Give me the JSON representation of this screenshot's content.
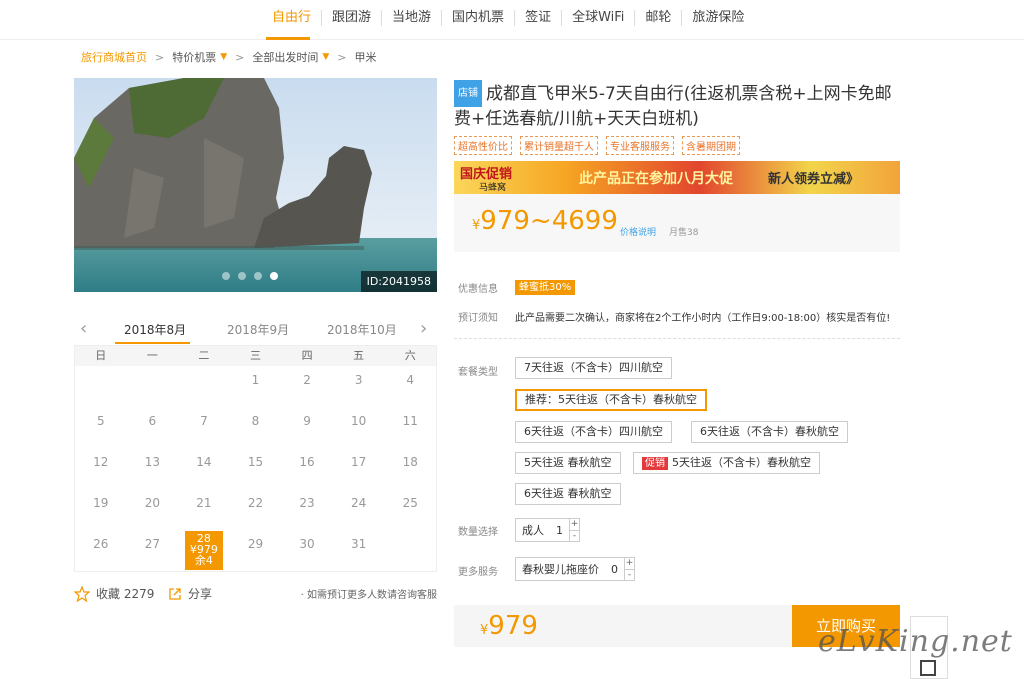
{
  "nav": {
    "items": [
      "自由行",
      "跟团游",
      "当地游",
      "国内机票",
      "签证",
      "全球WiFi",
      "邮轮",
      "旅游保险"
    ],
    "active": "自由行"
  },
  "breadcrumb": {
    "home": "旅行商城首页",
    "b1": "特价机票",
    "b2": "全部出发时间",
    "b3": "甲米"
  },
  "gallery": {
    "image_id": "ID:2041958",
    "slides": 4,
    "active_slide": 4
  },
  "calendar": {
    "months": [
      "2018年8月",
      "2018年9月",
      "2018年10月"
    ],
    "weekdays": [
      "日",
      "一",
      "二",
      "三",
      "四",
      "五",
      "六"
    ],
    "weeks": [
      [
        "",
        "",
        "",
        "1",
        "2",
        "3",
        "4"
      ],
      [
        "5",
        "6",
        "7",
        "8",
        "9",
        "10",
        "11"
      ],
      [
        "12",
        "13",
        "14",
        "15",
        "16",
        "17",
        "18"
      ],
      [
        "19",
        "20",
        "21",
        "22",
        "23",
        "24",
        "25"
      ],
      [
        "26",
        "27",
        "28",
        "29",
        "30",
        "31",
        ""
      ]
    ],
    "selected": {
      "day": "28",
      "price": "¥979",
      "stock": "余4"
    }
  },
  "actions": {
    "fav_label": "收藏 2279",
    "share_label": "分享",
    "note": "· 如需预订更多人数请咨询客服"
  },
  "product": {
    "shop_tag": "店铺",
    "title": "成都直飞甲米5-7天自由行(往返机票含税+上网卡免邮费+任选春航/川航+天天白班机)",
    "tags": [
      "超高性价比",
      "累计销量超千人",
      "专业客服服务",
      "含暑期团期"
    ]
  },
  "banner": {
    "t1": "国庆促销",
    "t2": "马蜂窝",
    "t3": "此产品正在参加八月大促",
    "t4": "新人领券立减》"
  },
  "price": {
    "symbol": "¥",
    "range": "979~4699",
    "explain": "价格说明",
    "sold": "月售38"
  },
  "info": {
    "discount_label": "优惠信息",
    "discount_value": "蜂蜜抵30%",
    "booking_label": "预订须知",
    "booking_value": "此产品需要二次确认，商家将在2个工作小时内（工作日9:00-18:00）核实是否有位!"
  },
  "packages": {
    "label": "套餐类型",
    "options": [
      "7天往返（不含卡）四川航空",
      "推荐：5天往返（不含卡）春秋航空",
      "6天往返（不含卡）四川航空",
      "6天往返（不含卡）春秋航空",
      "5天往返 春秋航空",
      "5天往返（不含卡）春秋航空",
      "6天往返 春秋航空"
    ],
    "promo_tag": "促销"
  },
  "quantity": {
    "label": "数量选择",
    "type": "成人",
    "value": "1"
  },
  "services": {
    "label": "更多服务",
    "name": "春秋婴儿拖座价",
    "value": "0"
  },
  "bottom": {
    "symbol": "¥",
    "price": "979",
    "buy_label": "立即购买"
  },
  "watermark": "eLvKing.net"
}
